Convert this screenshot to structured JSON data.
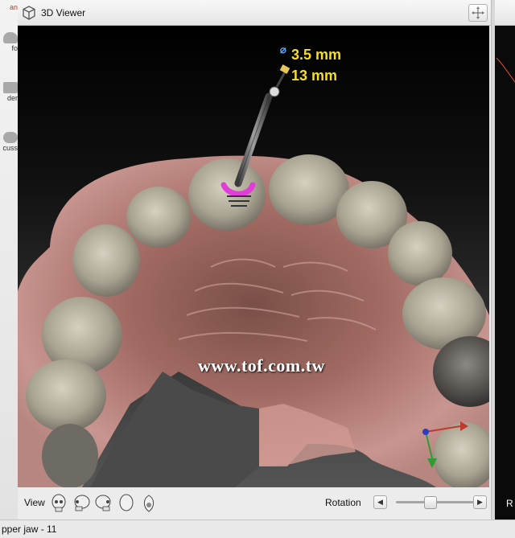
{
  "left_toolbar": {
    "top_red_label": "an",
    "items": [
      {
        "label": "fo"
      },
      {
        "label": "der"
      },
      {
        "label": "cuss"
      }
    ]
  },
  "viewer": {
    "title": "3D Viewer",
    "implant": {
      "diameter": "3.5 mm",
      "diameter_symbol": "⌀",
      "length": "13 mm"
    },
    "watermark": "www.tof.com.tw",
    "controls": {
      "view_label": "View",
      "view_icons": [
        "skull-front-icon",
        "skull-left-icon",
        "skull-right-icon",
        "skull-top-icon",
        "skull-bottom-icon"
      ],
      "rotation_label": "Rotation",
      "rotation_level_percent": 37
    }
  },
  "right_panel": {
    "footer_label": "R"
  },
  "status_bar": {
    "text": "pper jaw - 11"
  },
  "colors": {
    "measure_text": "#f5dd2a",
    "implant_marker": "#e23dd8",
    "axis_red": "#c0392b",
    "axis_green": "#2e9b34",
    "axis_blue": "#2a3fbf"
  }
}
